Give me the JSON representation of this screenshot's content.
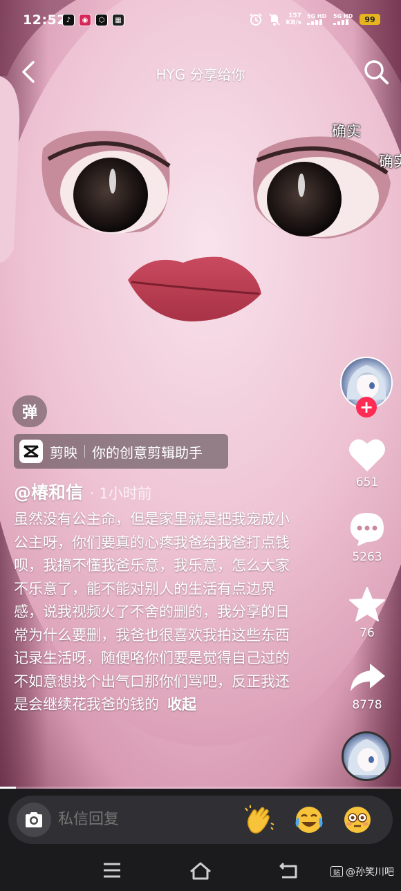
{
  "status_bar": {
    "time": "12:52",
    "app_icons": [
      "tiktok-icon",
      "music-icon",
      "box-icon",
      "meitu-icon"
    ],
    "net_speed_value": "157",
    "net_speed_unit": "KB/s",
    "signal_1": "5G HD",
    "signal_2": "5G HD",
    "battery": "99"
  },
  "header": {
    "title": "HYG 分享给你",
    "back_icon": "chevron-left-icon",
    "search_icon": "search-icon"
  },
  "danmaku": [
    "确实",
    "确实"
  ],
  "actions": {
    "like_count": "651",
    "comment_count": "5263",
    "favorite_count": "76",
    "share_count": "8778",
    "follow_symbol": "+"
  },
  "info": {
    "danmaku_toggle": "弹",
    "capcut_name": "剪映",
    "capcut_slogan": "你的创意剪辑助手",
    "author": "@椿和信",
    "post_time": "· 1小时前",
    "caption": "虽然没有公主命，但是家里就是把我宠成小公主呀，你们要真的心疼我爸给我爸打点钱呗，我搞不懂我爸乐意，我乐意，怎么大家不乐意了，能不能对别人的生活有点边界感，说我视频火了不舍的删的，我分享的日常为什么要删，我爸也很喜欢我拍这些东西记录生活呀，随便咯你们要是觉得自己过的不如意想找个出气口那你们骂吧，反正我还是会继续花我爸的钱的",
    "collapse": "收起",
    "progress": 0.04
  },
  "reply": {
    "placeholder": "私信回复",
    "emojis": [
      "clap-emoji-icon",
      "laugh-cry-emoji-icon",
      "flushed-emoji-icon"
    ]
  },
  "watermark": "@孙笑川吧",
  "colors": {
    "follow": "#fe2c55",
    "battery": "#e5b41f",
    "reply_bar": "#1b1b1d"
  }
}
